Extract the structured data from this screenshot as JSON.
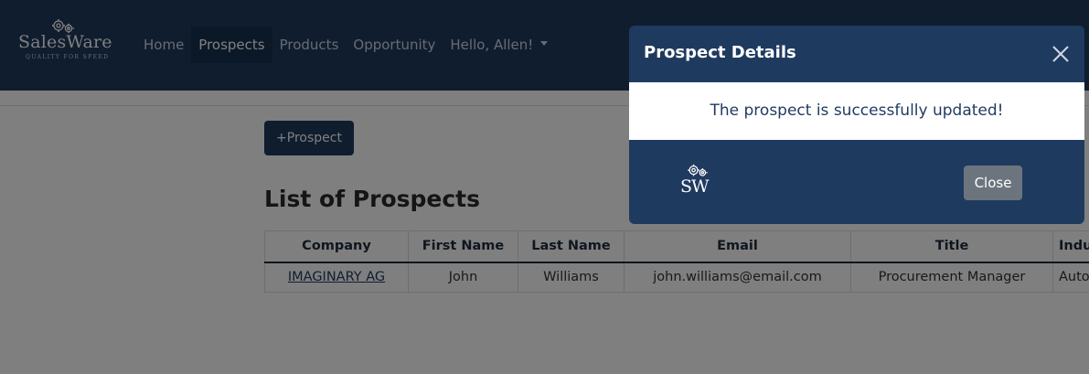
{
  "brand": {
    "name": "SalesWare",
    "tagline": "QUALITY FOR SPEED"
  },
  "nav": {
    "items": [
      {
        "label": "Home"
      },
      {
        "label": "Prospects"
      },
      {
        "label": "Products"
      },
      {
        "label": "Opportunity"
      }
    ],
    "user_menu": "Hello, Allen!"
  },
  "page": {
    "add_button": "+Prospect",
    "title": "List of Prospects"
  },
  "table": {
    "headers": [
      "Company",
      "First Name",
      "Last Name",
      "Email",
      "Title",
      "Industry"
    ],
    "rows": [
      [
        "IMAGINARY AG",
        "John",
        "Williams",
        "john.williams@email.com",
        "Procurement Manager",
        "Automotive"
      ]
    ]
  },
  "modal": {
    "title": "Prospect Details",
    "message": "The prospect is successfully updated!",
    "footer_logo": "SW",
    "close_button": "Close"
  },
  "colors": {
    "primary": "#1f3a5f",
    "secondary_button": "#6c757d",
    "backdrop": "rgba(0,0,0,0.5)"
  }
}
